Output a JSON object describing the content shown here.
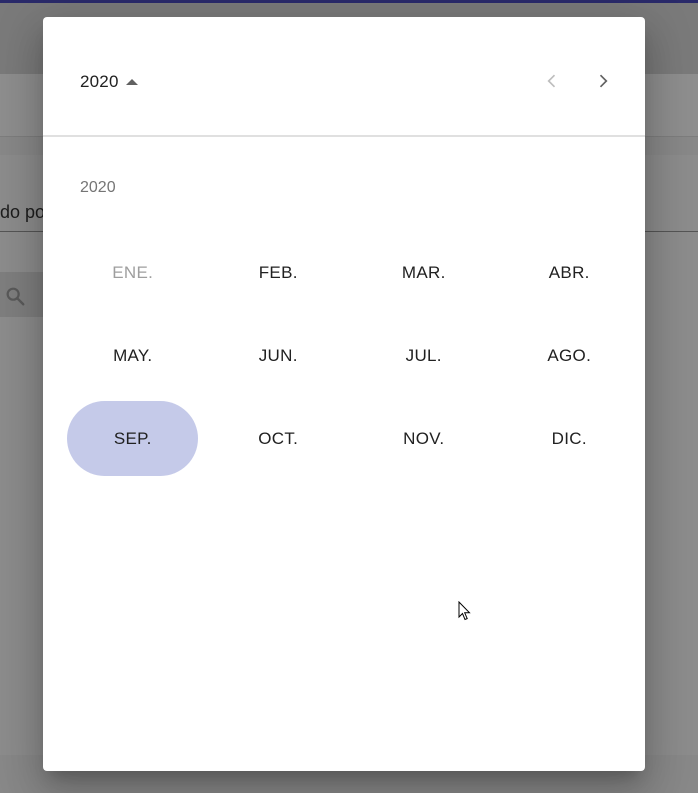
{
  "background": {
    "partial_text": "do po"
  },
  "picker": {
    "header_year": "2020",
    "year_label": "2020",
    "months": [
      {
        "label": "ENE.",
        "disabled": true,
        "selected": false
      },
      {
        "label": "FEB.",
        "disabled": false,
        "selected": false
      },
      {
        "label": "MAR.",
        "disabled": false,
        "selected": false
      },
      {
        "label": "ABR.",
        "disabled": false,
        "selected": false
      },
      {
        "label": "MAY.",
        "disabled": false,
        "selected": false
      },
      {
        "label": "JUN.",
        "disabled": false,
        "selected": false
      },
      {
        "label": "JUL.",
        "disabled": false,
        "selected": false
      },
      {
        "label": "AGO.",
        "disabled": false,
        "selected": false
      },
      {
        "label": "SEP.",
        "disabled": false,
        "selected": true
      },
      {
        "label": "OCT.",
        "disabled": false,
        "selected": false
      },
      {
        "label": "NOV.",
        "disabled": false,
        "selected": false
      },
      {
        "label": "DIC.",
        "disabled": false,
        "selected": false
      }
    ],
    "icons": {
      "prev": "chevron-left-icon",
      "next": "chevron-right-icon",
      "toggle": "caret-up-icon"
    },
    "colors": {
      "selected_bg": "#c5cae9",
      "disabled_text": "#9e9e9e"
    }
  }
}
